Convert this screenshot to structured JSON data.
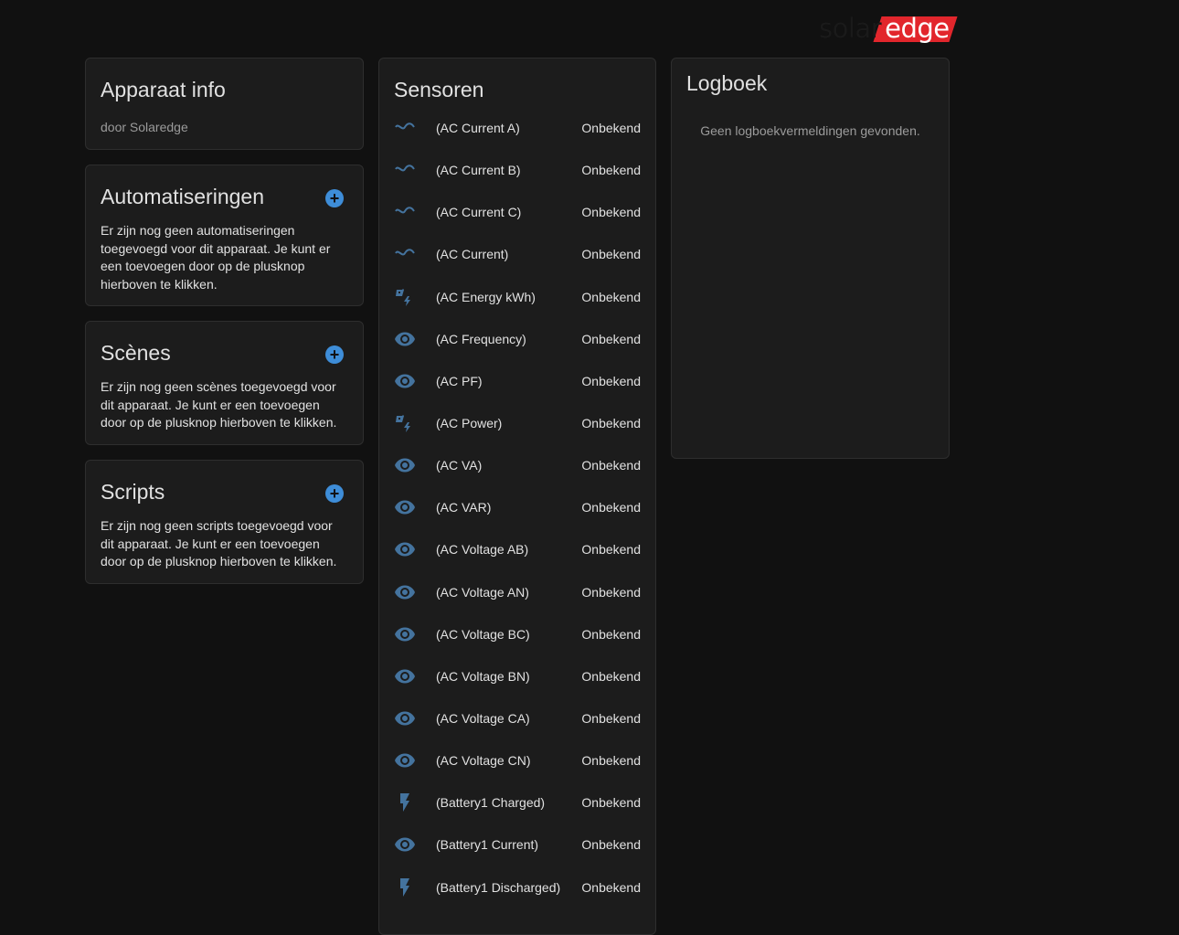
{
  "brand": {
    "logo_part1": "solar",
    "logo_part2": "edge",
    "accent": "#e2262c"
  },
  "device_info": {
    "title": "Apparaat info",
    "manufacturer": "door Solaredge"
  },
  "automations": {
    "title": "Automatiseringen",
    "text": "Er zijn nog geen automatiseringen toegevoegd voor dit apparaat. Je kunt er een toevoegen door op de plusknop hierboven te klikken."
  },
  "scenes": {
    "title": "Scènes",
    "text": "Er zijn nog geen scènes toegevoegd voor dit apparaat. Je kunt er een toevoegen door op de plusknop hierboven te klikken."
  },
  "scripts": {
    "title": "Scripts",
    "text": "Er zijn nog geen scripts toegevoegd voor dit apparaat. Je kunt er een toevoegen door op de plusknop hierboven te klikken."
  },
  "sensors": {
    "title": "Sensoren",
    "icon_color": "#44739e",
    "items": [
      {
        "name": "(AC Current A)",
        "state": "Onbekend",
        "icon": "current-ac-icon"
      },
      {
        "name": "(AC Current B)",
        "state": "Onbekend",
        "icon": "current-ac-icon"
      },
      {
        "name": "(AC Current C)",
        "state": "Onbekend",
        "icon": "current-ac-icon"
      },
      {
        "name": "(AC Current)",
        "state": "Onbekend",
        "icon": "current-ac-icon"
      },
      {
        "name": "(AC Energy kWh)",
        "state": "Onbekend",
        "icon": "solar-power-icon"
      },
      {
        "name": "(AC Frequency)",
        "state": "Onbekend",
        "icon": "eye-icon"
      },
      {
        "name": "(AC PF)",
        "state": "Onbekend",
        "icon": "eye-icon"
      },
      {
        "name": "(AC Power)",
        "state": "Onbekend",
        "icon": "solar-power-icon"
      },
      {
        "name": "(AC VA)",
        "state": "Onbekend",
        "icon": "eye-icon"
      },
      {
        "name": "(AC VAR)",
        "state": "Onbekend",
        "icon": "eye-icon"
      },
      {
        "name": "(AC Voltage AB)",
        "state": "Onbekend",
        "icon": "eye-icon"
      },
      {
        "name": "(AC Voltage AN)",
        "state": "Onbekend",
        "icon": "eye-icon"
      },
      {
        "name": "(AC Voltage BC)",
        "state": "Onbekend",
        "icon": "eye-icon"
      },
      {
        "name": "(AC Voltage BN)",
        "state": "Onbekend",
        "icon": "eye-icon"
      },
      {
        "name": "(AC Voltage CA)",
        "state": "Onbekend",
        "icon": "eye-icon"
      },
      {
        "name": "(AC Voltage CN)",
        "state": "Onbekend",
        "icon": "eye-icon"
      },
      {
        "name": "(Battery1 Charged)",
        "state": "Onbekend",
        "icon": "flash-icon"
      },
      {
        "name": "(Battery1 Current)",
        "state": "Onbekend",
        "icon": "eye-icon"
      },
      {
        "name": "(Battery1 Discharged)",
        "state": "Onbekend",
        "icon": "flash-icon"
      }
    ]
  },
  "logbook": {
    "title": "Logboek",
    "empty_text": "Geen logboekvermeldingen gevonden."
  }
}
